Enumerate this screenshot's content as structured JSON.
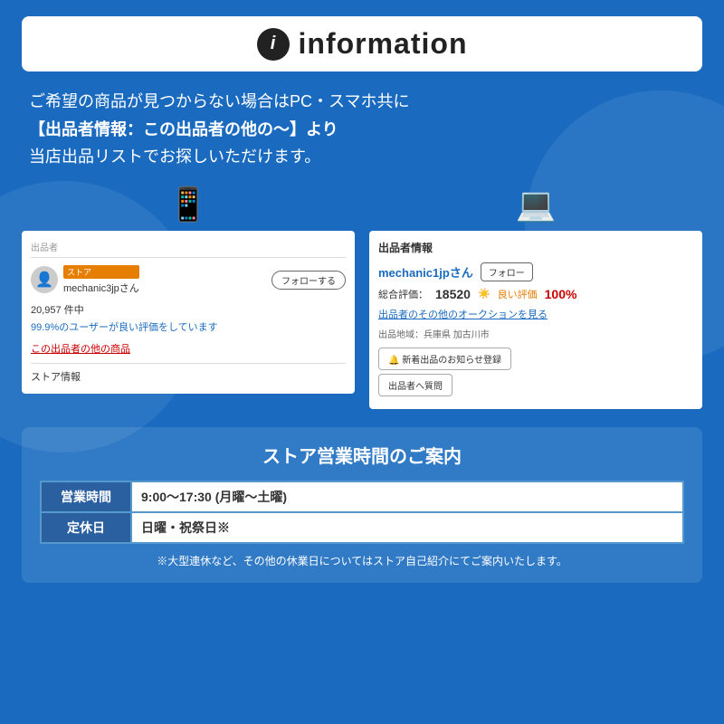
{
  "header": {
    "title": "information",
    "icon_label": "i"
  },
  "main_text": {
    "line1": "ご希望の商品が見つからない場合はPC・スマホ共に",
    "line2": "【出品者情報：この出品者の他の〜】より",
    "line3": "当店出品リストでお探しいただけます。"
  },
  "mobile_screenshot": {
    "section_label": "出品者",
    "store_badge": "ストア",
    "seller_name": "mechanic3jpさん",
    "follow_btn": "フォローする",
    "review_count": "20,957 件中",
    "review_pct": "99.9%のユーザーが良い評価をしています",
    "other_items_link": "この出品者の他の商品",
    "store_info": "ストア情報"
  },
  "pc_screenshot": {
    "section_label": "出品者情報",
    "seller_name": "mechanic1jpさん",
    "follow_btn": "フォロー",
    "rating_label": "総合評価：",
    "rating_num": "18520",
    "good_label": "良い評価",
    "pct": "100%",
    "auction_link": "出品者のその他のオークションを見る",
    "location": "出品地域：兵庫県 加古川市",
    "new_items_btn": "🔔 新着出品のお知らせ登録",
    "question_btn": "出品者へ質問"
  },
  "business": {
    "title": "ストア営業時間のご案内",
    "rows": [
      {
        "label": "営業時間",
        "value": "9:00〜17:30 (月曜〜土曜)"
      },
      {
        "label": "定休日",
        "value": "日曜・祝祭日※"
      }
    ],
    "note": "※大型連休など、その他の休業日についてはストア自己紹介にてご案内いたします。"
  }
}
